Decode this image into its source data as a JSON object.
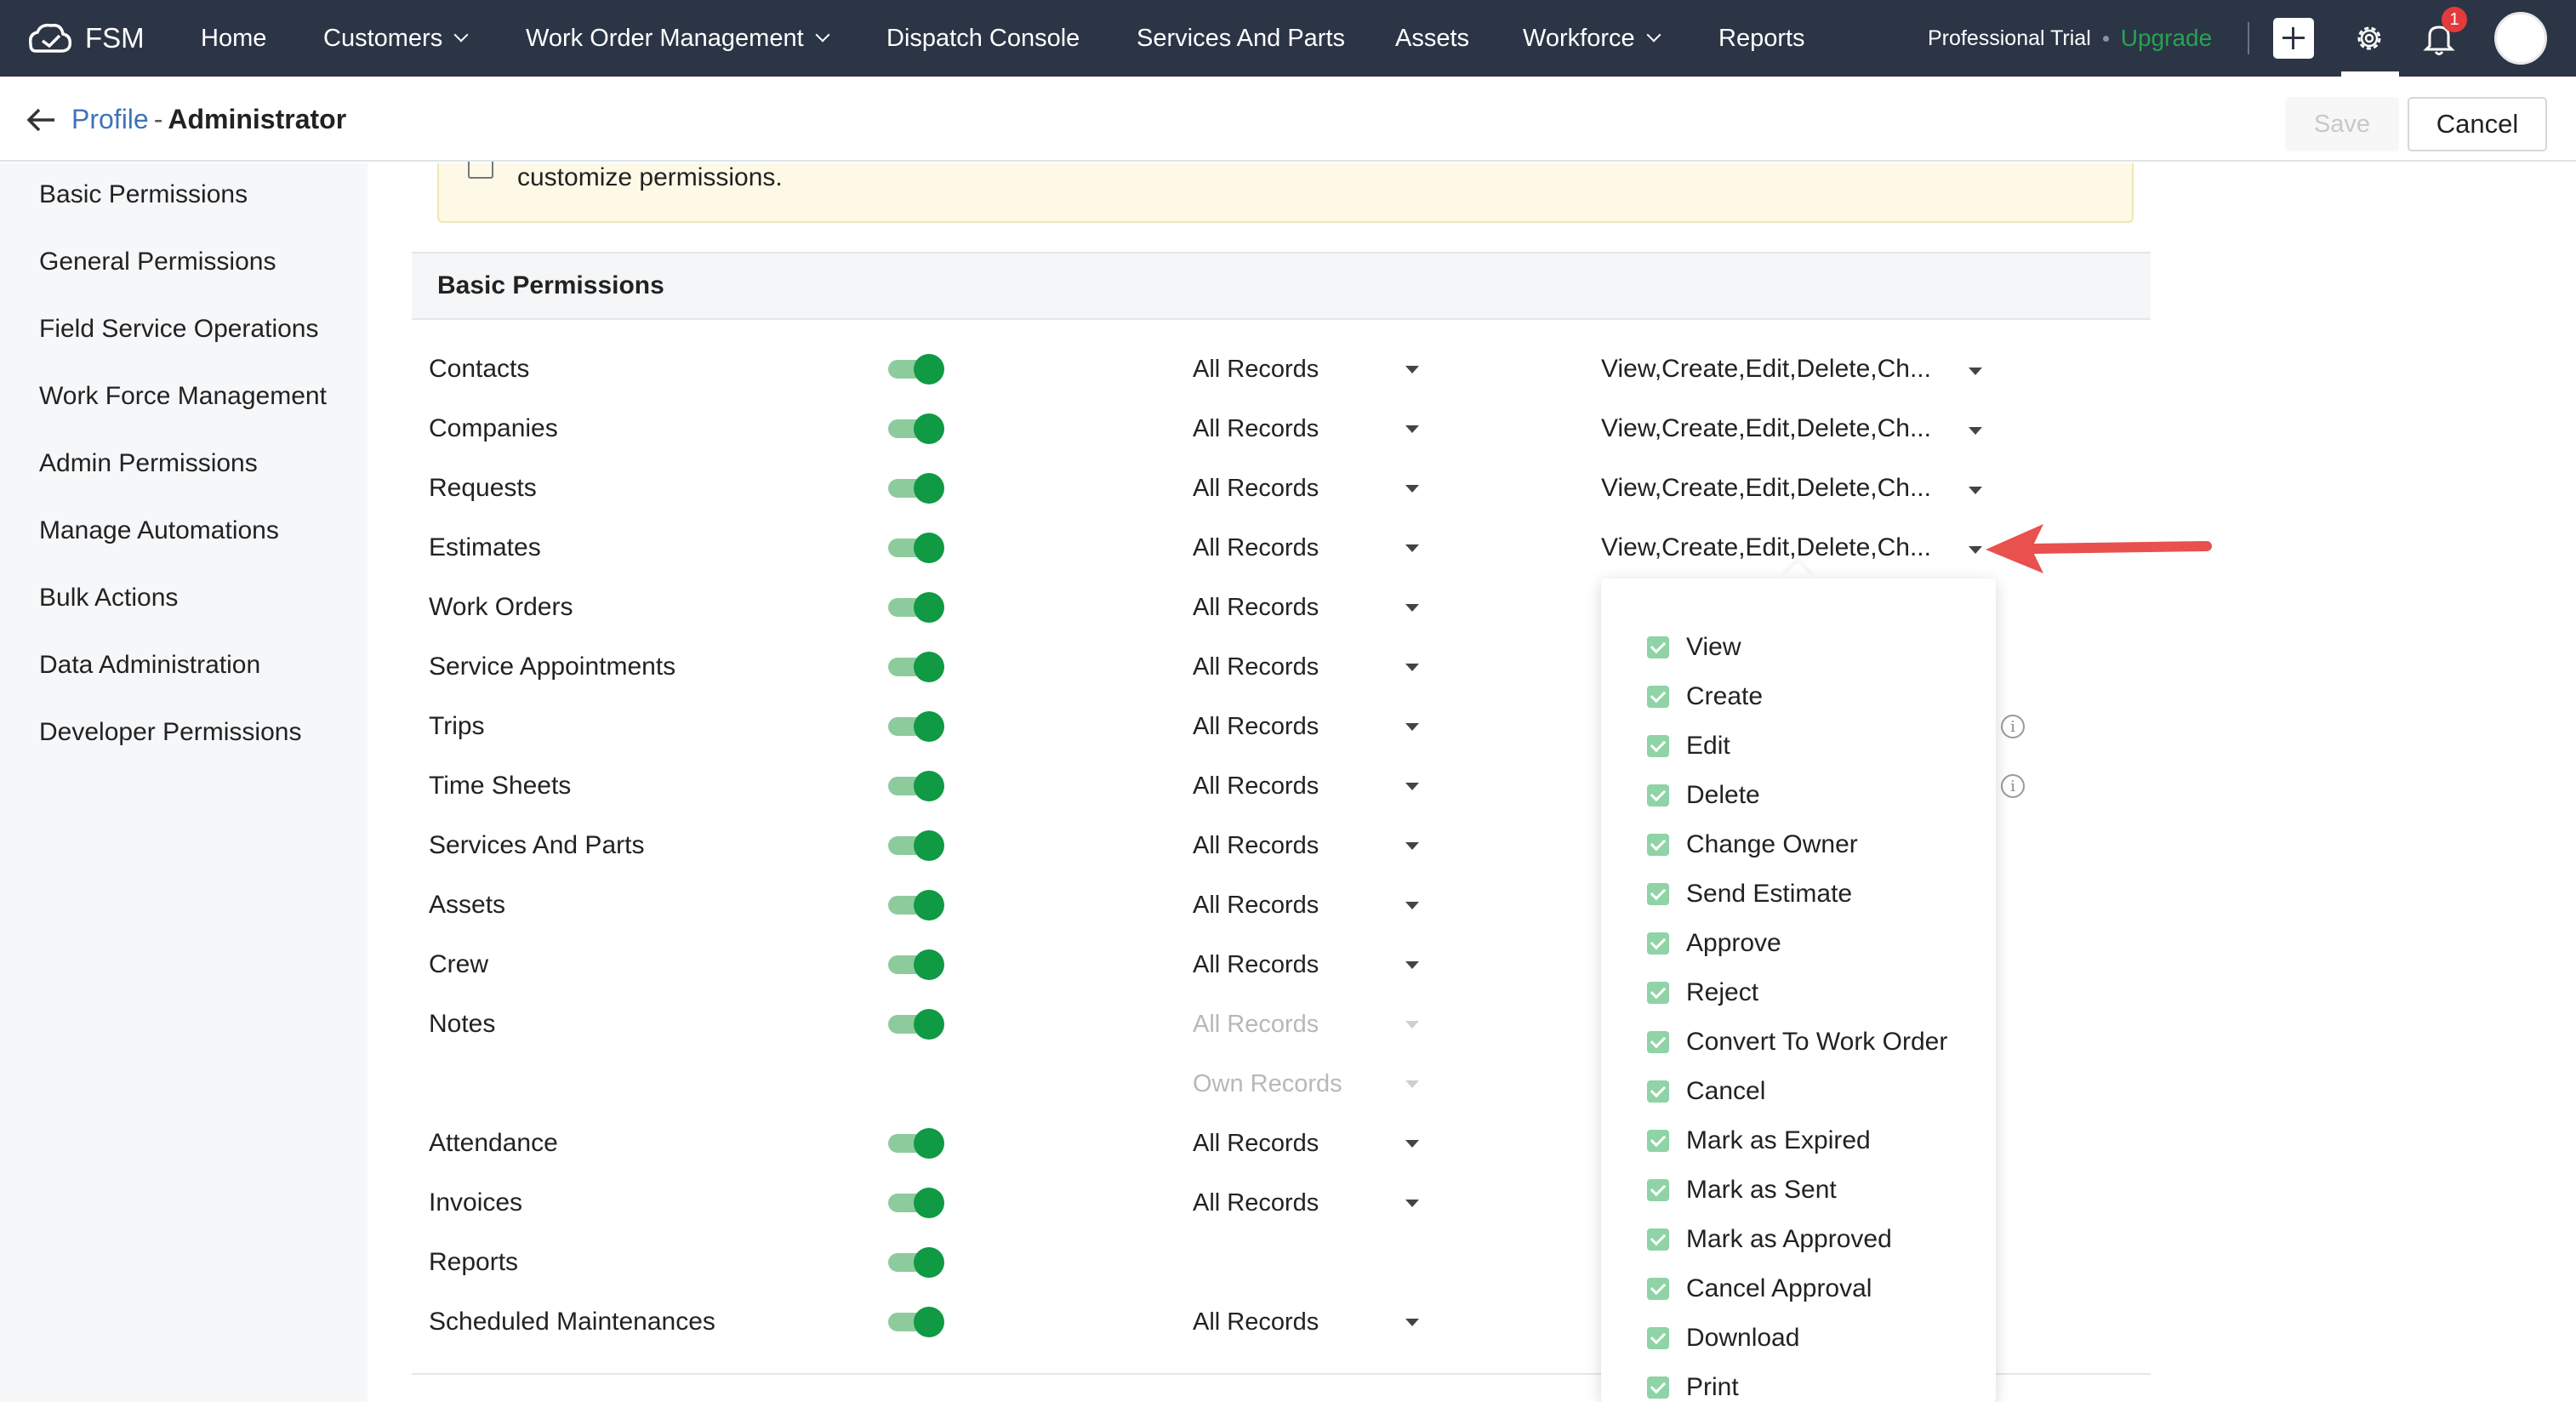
{
  "app": {
    "name": "FSM",
    "nav": [
      "Home",
      "Customers",
      "Work Order Management",
      "Dispatch Console",
      "Services And Parts",
      "Assets",
      "Workforce",
      "Reports"
    ],
    "trial_label": "Professional Trial",
    "upgrade_label": "Upgrade",
    "notification_count": "1",
    "colors": {
      "topbar": "#2c3545",
      "accent_green": "#0f9a43",
      "upgrade_green": "#26a352",
      "link_blue": "#3f73b8",
      "arrow_red": "#e8514d"
    }
  },
  "header": {
    "crumb_link": "Profile",
    "crumb_sep": "-",
    "crumb_current": "Administrator",
    "save_label": "Save",
    "cancel_label": "Cancel"
  },
  "sidebar": {
    "items": [
      "Basic Permissions",
      "General Permissions",
      "Field Service Operations",
      "Work Force Management",
      "Admin Permissions",
      "Manage Automations",
      "Bulk Actions",
      "Data Administration",
      "Developer Permissions"
    ]
  },
  "notice": {
    "text": "customize permissions."
  },
  "section": {
    "title": "Basic Permissions"
  },
  "rows": [
    {
      "name": "Contacts",
      "scope": "All Records",
      "perms": "View,Create,Edit,Delete,Ch..."
    },
    {
      "name": "Companies",
      "scope": "All Records",
      "perms": "View,Create,Edit,Delete,Ch..."
    },
    {
      "name": "Requests",
      "scope": "All Records",
      "perms": "View,Create,Edit,Delete,Ch..."
    },
    {
      "name": "Estimates",
      "scope": "All Records",
      "perms": "View,Create,Edit,Delete,Ch..."
    },
    {
      "name": "Work Orders",
      "scope": "All Records"
    },
    {
      "name": "Service Appointments",
      "scope": "All Records"
    },
    {
      "name": "Trips",
      "scope": "All Records"
    },
    {
      "name": "Time Sheets",
      "scope": "All Records"
    },
    {
      "name": "Services And Parts",
      "scope": "All Records"
    },
    {
      "name": "Assets",
      "scope": "All Records"
    },
    {
      "name": "Crew",
      "scope": "All Records"
    },
    {
      "name": "Notes",
      "scope": "All Records",
      "scope2": "Own Records"
    },
    {
      "name": "Attendance",
      "scope": "All Records"
    },
    {
      "name": "Invoices",
      "scope": "All Records"
    },
    {
      "name": "Reports"
    },
    {
      "name": "Scheduled Maintenances",
      "scope": "All Records"
    }
  ],
  "popup": {
    "options": [
      "View",
      "Create",
      "Edit",
      "Delete",
      "Change Owner",
      "Send Estimate",
      "Approve",
      "Reject",
      "Convert To Work Order",
      "Cancel",
      "Mark as Expired",
      "Mark as Sent",
      "Mark as Approved",
      "Cancel Approval",
      "Download",
      "Print"
    ]
  }
}
